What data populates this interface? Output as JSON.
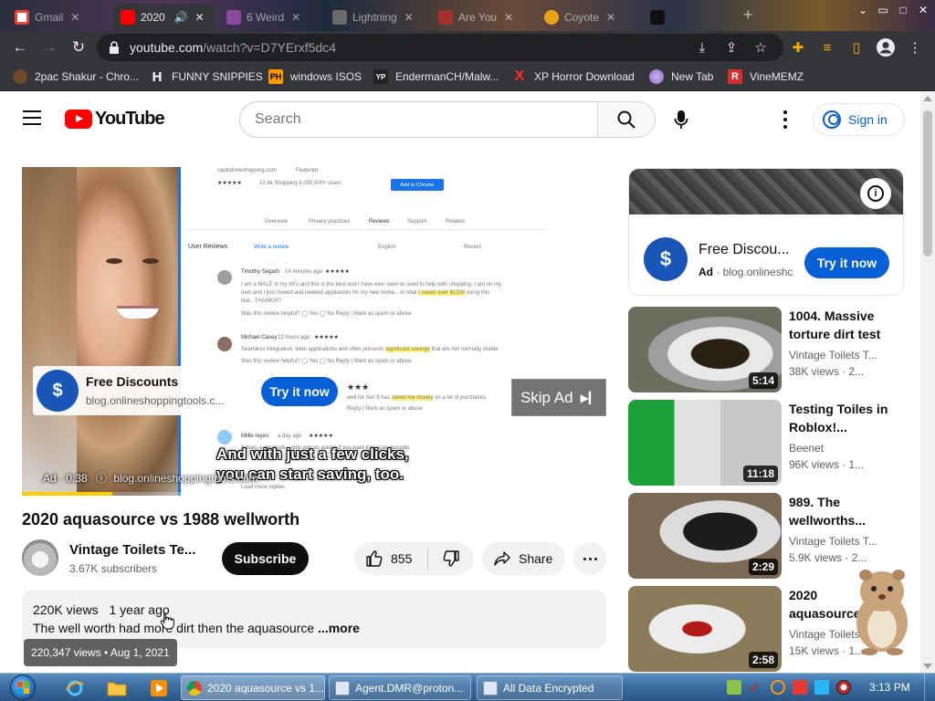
{
  "browser": {
    "tabs": [
      {
        "label": "Gmail",
        "fav_color": "#ea4335",
        "active": false
      },
      {
        "label": "2020",
        "fav_color": "#ff0000",
        "active": true
      },
      {
        "label": "6 Weird",
        "fav_color": "#8a4b9c",
        "active": false
      },
      {
        "label": "Lightning",
        "fav_color": "#6a6a6a",
        "active": false
      },
      {
        "label": "Are You",
        "fav_color": "#a3302c",
        "active": false
      },
      {
        "label": "Coyote",
        "fav_color": "#e8a317",
        "active": false
      },
      {
        "label": "",
        "fav_color": "#111111",
        "active": false
      }
    ],
    "url_host": "youtube.com",
    "url_path": "/watch?v=D7YErxf5dc4",
    "bookmarks": [
      {
        "label": "2pac Shakur - Chro...",
        "icon": "person-icon",
        "badge": "",
        "color": "#6b4b2b"
      },
      {
        "label": "FUNNY SNIPPIES",
        "icon": "h-icon",
        "badge": "H",
        "color": "#2b2b2b"
      },
      {
        "label": "windows ISOS",
        "icon": "ph-icon",
        "badge": "PH",
        "color": "#ff9900"
      },
      {
        "label": "EndermanCH/Malw...",
        "icon": "yp-icon",
        "badge": "YP",
        "color": "#333333"
      },
      {
        "label": "XP Horror Download",
        "icon": "x-icon",
        "badge": "X",
        "color": "#35363a"
      },
      {
        "label": "New Tab",
        "icon": "globe-icon",
        "badge": "",
        "color": "#8e6cc5"
      },
      {
        "label": "VineMEMZ",
        "icon": "r-icon",
        "badge": "R",
        "color": "#d32f2f"
      }
    ]
  },
  "youtube": {
    "logo_text": "YouTube",
    "search_placeholder": "Search",
    "sign_in": "Sign in"
  },
  "player": {
    "ad_card_title": "Free Discounts",
    "ad_card_url": "blog.onlineshoppingtools.c...",
    "try_label": "Try it now",
    "skip_label": "Skip Ad",
    "caption_line1": "And with just a few clicks,",
    "caption_line2": "you can start saving, too.",
    "ad_timer": "Ad · 0:38",
    "ad_timer_url": "blog.onlineshoppingtools.com",
    "progress": 0.155,
    "progress_color": "#ffcc00",
    "page": {
      "site": "capitaloneshopping.com",
      "featured": "Featured",
      "rating_meta": "10.8k    Shopping    6,000,000+ users",
      "add_button": "Add to Chrome",
      "nav": [
        "Overview",
        "Privacy practices",
        "Reviews",
        "Support",
        "Related"
      ],
      "user_reviews": "User Reviews",
      "write_review": "Write a review",
      "lang": "English",
      "sort": "Recent",
      "reviews": [
        {
          "name": "Timothy Segarti",
          "ago": "14 minutes ago",
          "line1": "I am a MALE in my 60's and this is the best tool I have ever seen or used to help with shopping. I am on my",
          "line2": "own and I just moved and needed appliances for my new home... in total",
          "highlight": "I saved over $1200",
          "line2b": "using this",
          "line3": "tool...THANKS!!!"
        },
        {
          "name": "Michael Casey",
          "ago": "22 hours ago",
          "line1": "Seamless integration, wide applications and often presents",
          "highlight": "significant savings",
          "line1b": "that are not normally visible",
          "line2": "",
          "line3": ""
        },
        {
          "name": "",
          "ago": "",
          "line1": "well for me! It has",
          "highlight": "saved me money",
          "line1b": "on a lot of purchases.",
          "line2": "",
          "line3": ""
        },
        {
          "name": "Millie reyes",
          "ago": "a day ago",
          "line1": "It does a great job... only pop up asking if you want it to scan possible",
          "highlight": "",
          "line2": "",
          "line3": ""
        }
      ],
      "helpful": "Was this review helpful?",
      "yes": "Yes",
      "no": "No",
      "reply": "Reply",
      "mark_spam": "Mark as spam or abuse",
      "load_more": "Load more replies"
    }
  },
  "video": {
    "title": "2020 aquasource vs 1988 wellworth",
    "channel": "Vintage Toilets Te...",
    "subscribers": "3.67K subscribers",
    "subscribe": "Subscribe",
    "likes": "855",
    "share": "Share",
    "views": "220K views",
    "ago": "1 year ago",
    "description": "The well worth had more dirt then the aquasource",
    "more": "...more",
    "tooltip": "220,347 views • Aug 1, 2021"
  },
  "side_ad": {
    "title": "Free Discou...",
    "ad_label": "Ad",
    "url": "blog.onlineshc",
    "try_label": "Try it now"
  },
  "recommendations": [
    {
      "title": "1004. Massive torture dirt test",
      "channel": "Vintage Toilets T...",
      "views": "38K views · 2...",
      "duration": "5:14",
      "thumb": "dirt-bowl"
    },
    {
      "title": "Testing Toiles in Roblox!...",
      "channel": "Beenet",
      "views": "96K views · 1...",
      "duration": "11:18",
      "thumb": "roblox"
    },
    {
      "title": "989. The wellworths...",
      "channel": "Vintage Toilets T...",
      "views": "5.9K views · 2...",
      "duration": "2:29",
      "thumb": "dark-bowl"
    },
    {
      "title": "2020 aquasource...",
      "channel": "Vintage Toilets",
      "views": "15K views · 1...",
      "duration": "2:58",
      "thumb": "plunger"
    }
  ],
  "taskbar": {
    "tasks": [
      {
        "label": "2020 aquasource vs 1...",
        "icon": "chrome-icon",
        "active": true
      },
      {
        "label": "Agent.DMR@proton...",
        "icon": "window-icon",
        "active": false
      },
      {
        "label": "All Data Encrypted",
        "icon": "window-icon",
        "active": false
      }
    ],
    "clock": "3:13 PM"
  }
}
